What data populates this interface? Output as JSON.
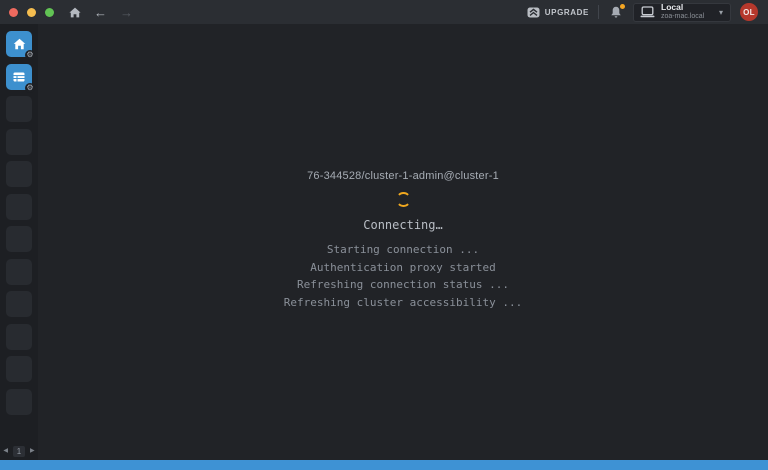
{
  "colors": {
    "accent_blue": "#3d90ce",
    "statusbar_blue": "#3e92d4",
    "spinner_orange": "#f0a81f",
    "notification_orange": "#f5a623",
    "avatar_red": "#b5382c",
    "topbar_bg": "#2b2e33",
    "sidebar_bg": "#1d1f23",
    "content_bg": "#212327"
  },
  "icons": {
    "back": "←",
    "forward": "→",
    "caret_down": "▾",
    "gear": "⚙",
    "prev_page": "◀",
    "next_page": "▶"
  },
  "topbar": {
    "upgrade_label": "UPGRADE",
    "cluster_select": {
      "selected": "Local",
      "subtitle": "zoa-mac.local"
    },
    "avatar_initials": "OL"
  },
  "hotbar": {
    "active_items": [
      "home",
      "catalog"
    ],
    "empty_slot_count": 10,
    "pagination": {
      "page": "1"
    }
  },
  "main": {
    "connection_title": "76-344528/cluster-1-admin@cluster-1",
    "status_heading": "Connecting…",
    "status_lines": [
      "Starting connection ...",
      "Authentication proxy started",
      "Refreshing connection status ...",
      "Refreshing cluster accessibility ..."
    ]
  }
}
